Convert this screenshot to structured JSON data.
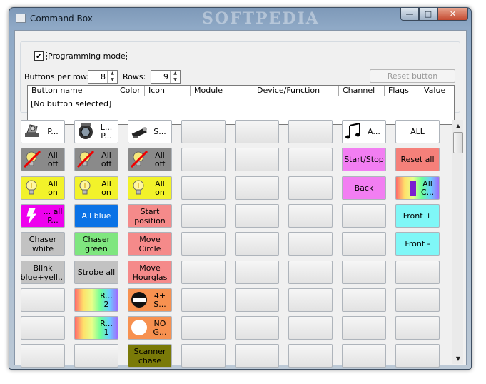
{
  "window": {
    "title": "Command Box",
    "watermark": "SOFTPEDIA",
    "controls": {
      "minimize": "—",
      "maximize": "□",
      "close": "✕"
    }
  },
  "settings": {
    "programming_mode_label": "Programming mode",
    "programming_mode_checked": true,
    "buttons_per_row_label": "Buttons per row:",
    "buttons_per_row_value": "8",
    "rows_label": "Rows:",
    "rows_value": "9",
    "reset_button_label": "Reset button"
  },
  "table": {
    "columns": [
      "Button name",
      "Color",
      "Icon",
      "Module",
      "Device/Function",
      "Channel",
      "Flags",
      "Value"
    ],
    "rows": [
      "[No button selected]"
    ]
  },
  "grid": {
    "buttons_per_row": 8,
    "rows": 9,
    "buttons": [
      {
        "row": 0,
        "col": 0,
        "label": "P...",
        "color": "white",
        "icon": "moving-head-light-icon"
      },
      {
        "row": 0,
        "col": 1,
        "label": "L... P...",
        "color": "white",
        "icon": "par-can-light-icon"
      },
      {
        "row": 0,
        "col": 2,
        "label": "S...",
        "color": "white",
        "icon": "scanner-light-icon"
      },
      {
        "row": 0,
        "col": 6,
        "label": "A...",
        "color": "white",
        "icon": "music-notes-icon"
      },
      {
        "row": 0,
        "col": 7,
        "label": "ALL",
        "color": "white",
        "icon": ""
      },
      {
        "row": 1,
        "col": 0,
        "label": "All off",
        "color": "gray",
        "icon": "bulb-off-icon"
      },
      {
        "row": 1,
        "col": 1,
        "label": "All off",
        "color": "gray",
        "icon": "bulb-off-icon"
      },
      {
        "row": 1,
        "col": 2,
        "label": "All off",
        "color": "gray",
        "icon": "bulb-off-icon"
      },
      {
        "row": 1,
        "col": 6,
        "label": "Start/Stop",
        "color": "violet",
        "icon": ""
      },
      {
        "row": 1,
        "col": 7,
        "label": "Reset all",
        "color": "salmon",
        "icon": ""
      },
      {
        "row": 2,
        "col": 0,
        "label": "All on",
        "color": "yellow",
        "icon": "bulb-on-icon"
      },
      {
        "row": 2,
        "col": 1,
        "label": "All on",
        "color": "yellow",
        "icon": "bulb-on-icon"
      },
      {
        "row": 2,
        "col": 2,
        "label": "All on",
        "color": "yellow",
        "icon": "bulb-on-icon"
      },
      {
        "row": 2,
        "col": 6,
        "label": "Back",
        "color": "violet",
        "icon": ""
      },
      {
        "row": 2,
        "col": 7,
        "label": "All C...",
        "color": "rainbow",
        "icon": "color-wheel-icon"
      },
      {
        "row": 3,
        "col": 0,
        "label": "... all P...",
        "color": "magenta",
        "icon": "strobe-flash-icon"
      },
      {
        "row": 3,
        "col": 1,
        "label": "All blue",
        "color": "blue",
        "icon": ""
      },
      {
        "row": 3,
        "col": 2,
        "label": "Start position",
        "color": "pink",
        "icon": ""
      },
      {
        "row": 3,
        "col": 7,
        "label": "Front +",
        "color": "cyan",
        "icon": ""
      },
      {
        "row": 4,
        "col": 0,
        "label": "Chaser white",
        "color": "silver",
        "icon": ""
      },
      {
        "row": 4,
        "col": 1,
        "label": "Chaser green",
        "color": "green",
        "icon": ""
      },
      {
        "row": 4,
        "col": 2,
        "label": "Move Circle",
        "color": "pink",
        "icon": ""
      },
      {
        "row": 4,
        "col": 7,
        "label": "Front -",
        "color": "cyan",
        "icon": ""
      },
      {
        "row": 5,
        "col": 0,
        "label": "Blink blue+yell...",
        "color": "silver",
        "icon": ""
      },
      {
        "row": 5,
        "col": 1,
        "label": "Strobe all",
        "color": "silver",
        "icon": ""
      },
      {
        "row": 5,
        "col": 2,
        "label": "Move Hourglas",
        "color": "pink",
        "icon": ""
      },
      {
        "row": 6,
        "col": 1,
        "label": "R... 2",
        "color": "rainbow",
        "icon": "color-gradient-icon"
      },
      {
        "row": 6,
        "col": 2,
        "label": "4+ S...",
        "color": "orange",
        "icon": "gobo-wheel-icon"
      },
      {
        "row": 7,
        "col": 1,
        "label": "R... 1",
        "color": "rainbow",
        "icon": "color-gradient-icon"
      },
      {
        "row": 7,
        "col": 2,
        "label": "NO G...",
        "color": "orange",
        "icon": "open-gobo-icon"
      },
      {
        "row": 8,
        "col": 2,
        "label": "Scanner chase",
        "color": "olive",
        "icon": ""
      }
    ]
  },
  "colors": {
    "white": "#ffffff",
    "gray": "#8a8a8a",
    "yellow": "#f2f22a",
    "magenta": "#ee00ee",
    "blue": "#0a72e6",
    "pink": "#f58a8a",
    "silver": "#c2c2c2",
    "green": "#7fe67f",
    "orange": "#f79150",
    "olive": "#7a7a08",
    "violet": "#f27ef2",
    "salmon": "#f5807a",
    "cyan": "#7ff7f7"
  },
  "scrollbar": {
    "up": "▲",
    "down": "▼"
  }
}
